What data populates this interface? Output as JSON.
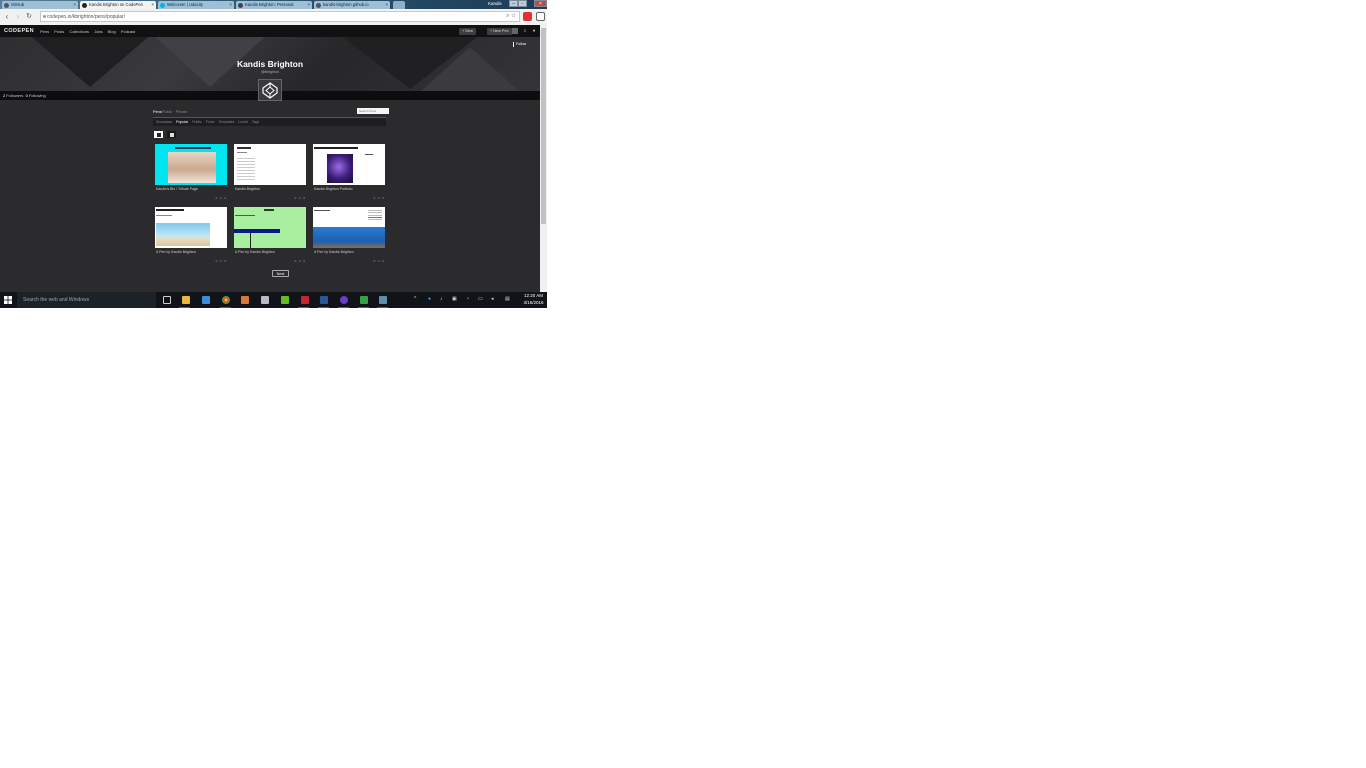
{
  "browser": {
    "tabs": [
      {
        "label": "GitHub",
        "active": false
      },
      {
        "label": "Kandis Brighton on CodePen",
        "active": true
      },
      {
        "label": "Welcome! | Udacity",
        "active": false
      },
      {
        "label": "Kandis Brighton: Personal",
        "active": false
      },
      {
        "label": "kandis-brighton.github.io",
        "active": false
      }
    ],
    "user": "Kandis",
    "url": "codepen.io/kbrighton/pens/popular/"
  },
  "site": {
    "logo": "CODEPEN",
    "nav": [
      "Pens",
      "Posts",
      "Collections",
      "Jobs",
      "Blog",
      "Podcast"
    ],
    "new_button": "+ New",
    "new_pen_button": "+ New Pen"
  },
  "profile": {
    "name": "Kandis Brighton",
    "handle": "@kbrighton",
    "follow": "Follow",
    "stats": [
      {
        "count": "2",
        "label": "Followers"
      },
      {
        "count": "0",
        "label": "Following"
      }
    ]
  },
  "content": {
    "filter_label": "Pens",
    "filter_sub": "Public · Private",
    "search_placeholder": "Search Pens",
    "sort_options": [
      "Showcase",
      "Popular",
      "Public",
      "Forks",
      "Templates",
      "Loved",
      "Tags"
    ],
    "active_sort": "Popular",
    "cards": [
      {
        "title": "Kandis's Bio / Tribute Page"
      },
      {
        "title": "Kandis Brighton"
      },
      {
        "title": "Kandis Brighton Portfolio"
      },
      {
        "title": "A Pen by Kandis Brighton"
      },
      {
        "title": "A Pen by Kandis Brighton"
      },
      {
        "title": "A Pen by Kandis Brighton"
      }
    ],
    "card_meta": "0 · 2 · 0",
    "next_button": "Next"
  },
  "taskbar": {
    "search_placeholder": "Search the web and Windows",
    "time": "12:20 AM",
    "date": "3/16/2016"
  },
  "colors": {
    "page_bg": "#2b2b2e",
    "header_bg": "#111112",
    "accent_cyan": "#00e5f0",
    "accent_green": "#a8f0a0",
    "taskbar_bg": "#101418"
  }
}
